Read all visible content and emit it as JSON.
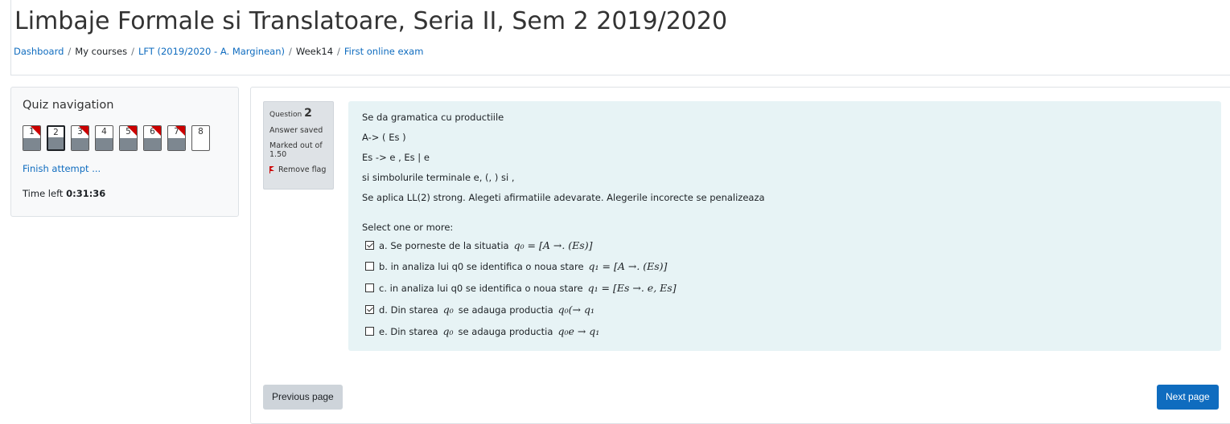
{
  "page": {
    "title": "Limbaje Formale si Translatoare, Seria II, Sem 2 2019/2020"
  },
  "breadcrumb": [
    {
      "label": "Dashboard",
      "link": true
    },
    {
      "label": "My courses",
      "link": false
    },
    {
      "label": "LFT (2019/2020 - A. Marginean)",
      "link": true
    },
    {
      "label": "Week14",
      "link": false
    },
    {
      "label": "First online exam",
      "link": true
    }
  ],
  "quiz_nav": {
    "heading": "Quiz navigation",
    "questions": [
      {
        "num": "1",
        "answered": true,
        "flagged": true,
        "current": false
      },
      {
        "num": "2",
        "answered": true,
        "flagged": false,
        "current": true
      },
      {
        "num": "3",
        "answered": true,
        "flagged": true,
        "current": false
      },
      {
        "num": "4",
        "answered": true,
        "flagged": false,
        "current": false
      },
      {
        "num": "5",
        "answered": true,
        "flagged": true,
        "current": false
      },
      {
        "num": "6",
        "answered": true,
        "flagged": true,
        "current": false
      },
      {
        "num": "7",
        "answered": true,
        "flagged": true,
        "current": false
      },
      {
        "num": "8",
        "answered": false,
        "flagged": false,
        "current": false
      }
    ],
    "finish_label": "Finish attempt ...",
    "time_left_label": "Time left",
    "time_left_value": "0:31:36"
  },
  "question_info": {
    "label": "Question",
    "number": "2",
    "state": "Answer saved",
    "marked_out_of": "Marked out of 1.50",
    "flag_label": "Remove flag",
    "flag_color": "#cc0000"
  },
  "question": {
    "lines": [
      "Se da gramatica cu productiile",
      "A-> ( Es )",
      "Es -> e , Es | e",
      "si simbolurile terminale e, (, ) si ,",
      "Se aplica LL(2) strong. Alegeti afirmatiile adevarate. Alegerile incorecte se penalizeaza"
    ],
    "prompt": "Select one or more:",
    "answers": [
      {
        "text": "a. Se porneste de la situatia",
        "formula": "q₀ = [A →. (Es)]",
        "checked": true
      },
      {
        "text": "b. in analiza lui q0 se identifica o noua stare",
        "formula": "q₁ = [A →. (Es)]",
        "checked": false
      },
      {
        "text": "c. in analiza lui q0 se identifica o noua stare",
        "formula": "q₁ = [Es →. e, Es]",
        "checked": false
      },
      {
        "text": "d. Din starea",
        "formula": "q₀",
        "text2": "se adauga productia",
        "formula2": "q₀(→ q₁",
        "checked": true
      },
      {
        "text": "e. Din starea",
        "formula": "q₀",
        "text2": "se adauga productia",
        "formula2": "q₀e → q₁",
        "checked": false
      }
    ],
    "background": "#e7f3f5"
  },
  "buttons": {
    "previous": "Previous page",
    "next": "Next page"
  },
  "colors": {
    "link": "#0f6cbf",
    "primary_button": "#0f6cbf",
    "flag": "#cc0000"
  }
}
